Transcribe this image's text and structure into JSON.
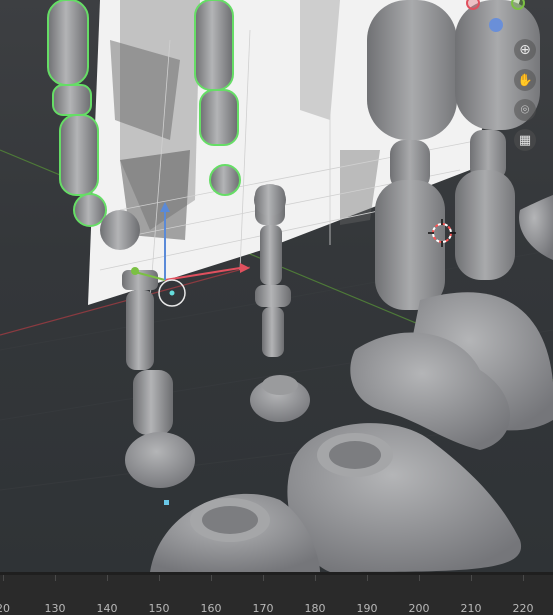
{
  "viewport": {
    "gizmo_axes": [
      {
        "name": "x-axis-dot",
        "color": "#e0505e"
      },
      {
        "name": "z-axis-dot",
        "color": "#6a8fd8"
      },
      {
        "name": "y-axis-dot",
        "color": "#7bc043"
      }
    ],
    "tools": [
      {
        "name": "zoom-icon",
        "glyph": "⊕"
      },
      {
        "name": "pan-hand-icon",
        "glyph": "✋"
      },
      {
        "name": "camera-view-icon",
        "glyph": "⌾"
      },
      {
        "name": "perspective-grid-icon",
        "glyph": "▦"
      }
    ]
  },
  "timeline": {
    "ticks": [
      "20",
      "130",
      "140",
      "150",
      "160",
      "170",
      "180",
      "190",
      "200",
      "210",
      "220"
    ]
  }
}
